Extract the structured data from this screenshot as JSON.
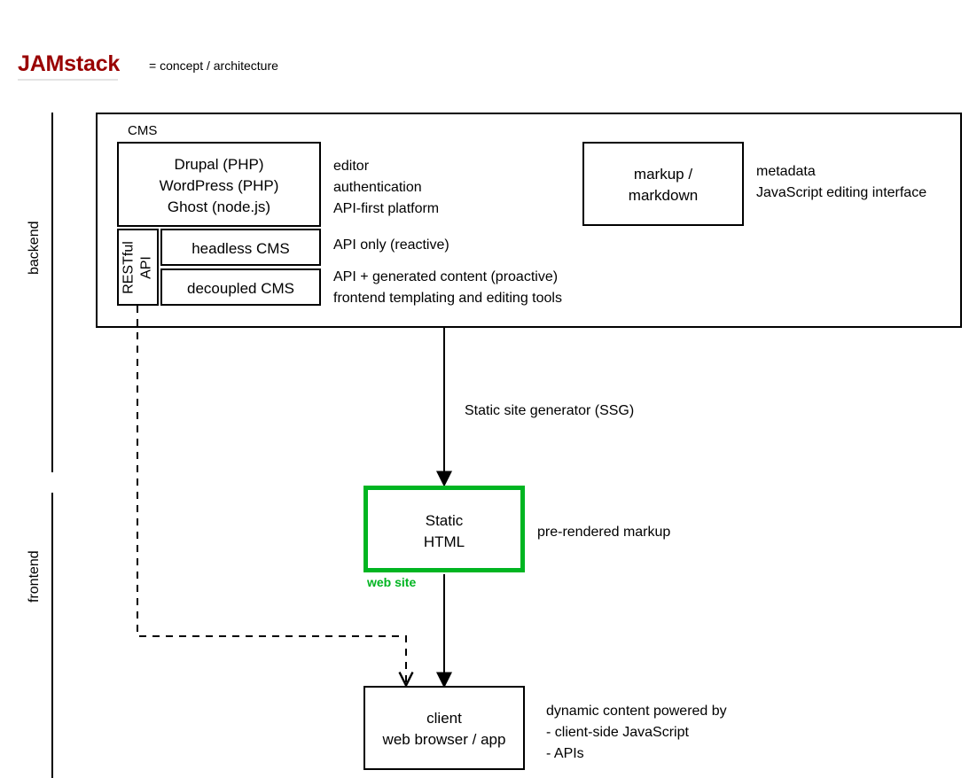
{
  "title": {
    "name": "JAMstack",
    "note": "= concept / architecture",
    "color": "#990000"
  },
  "rails": [
    {
      "label": "backend"
    },
    {
      "label": "frontend"
    }
  ],
  "backend": {
    "container_caption": "CMS",
    "cms_platforms_box": {
      "lines": "Drupal (PHP)\nWordPress (PHP)\nGhost (node.js)\n..."
    },
    "cms_platforms_note": "editor\nauthentication\nAPI-first platform",
    "restful_api_label": "RESTful\nAPI",
    "headless_box": {
      "label": "headless CMS"
    },
    "headless_note": "API only (reactive)",
    "decoupled_box": {
      "label": "decoupled CMS"
    },
    "decoupled_note": "API + generated content (proactive)\nfrontend templating and editing tools",
    "markup_box": {
      "label": "markup /\nmarkdown"
    },
    "markup_note": "metadata\nJavaScript editing interface"
  },
  "connectors": {
    "ssg_label": "Static site generator (SSG)"
  },
  "frontend": {
    "static_html_box": {
      "label": "Static\nHTML"
    },
    "static_html_caption": "web site",
    "static_html_note": "pre-rendered markup",
    "static_html_color": "#00b521",
    "client_box": {
      "label": "client\nweb browser / app"
    },
    "client_note": "dynamic content powered by\n- client-side JavaScript\n- APIs"
  }
}
